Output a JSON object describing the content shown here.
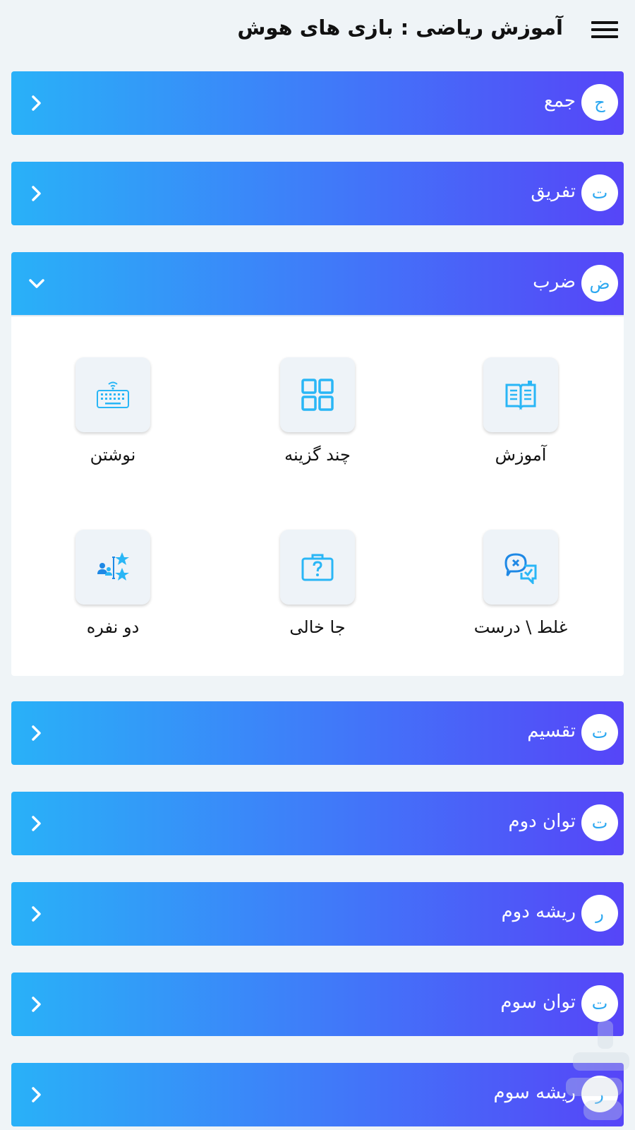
{
  "header": {
    "title": "آموزش ریاضی : بازی های هوش",
    "menu_icon": "hamburger-menu-icon"
  },
  "colors": {
    "gradient_start": "#29b1f8",
    "gradient_end": "#5645f8",
    "accent_icon": "#29b6f6",
    "background": "#eff4f7"
  },
  "sections": [
    {
      "letter": "ج",
      "label": "جمع",
      "expanded": false
    },
    {
      "letter": "ت",
      "label": "تفریق",
      "expanded": false
    },
    {
      "letter": "ض",
      "label": "ضرب",
      "expanded": true
    },
    {
      "letter": "ت",
      "label": "تقسیم",
      "expanded": false
    },
    {
      "letter": "ت",
      "label": "توان دوم",
      "expanded": false
    },
    {
      "letter": "ر",
      "label": "ریشه دوم",
      "expanded": false
    },
    {
      "letter": "ت",
      "label": "توان سوم",
      "expanded": false
    },
    {
      "letter": "ر",
      "label": "ریشه سوم",
      "expanded": false
    }
  ],
  "expanded_panel": {
    "tiles": [
      {
        "label": "آموزش",
        "icon": "book-icon"
      },
      {
        "label": "چند گزینه",
        "icon": "grid-icon"
      },
      {
        "label": "نوشتن",
        "icon": "keyboard-icon"
      },
      {
        "label": "غلط \\ درست",
        "icon": "chat-check-icon"
      },
      {
        "label": "جا خالی",
        "icon": "question-briefcase-icon"
      },
      {
        "label": "دو نفره",
        "icon": "users-stars-icon"
      }
    ]
  }
}
